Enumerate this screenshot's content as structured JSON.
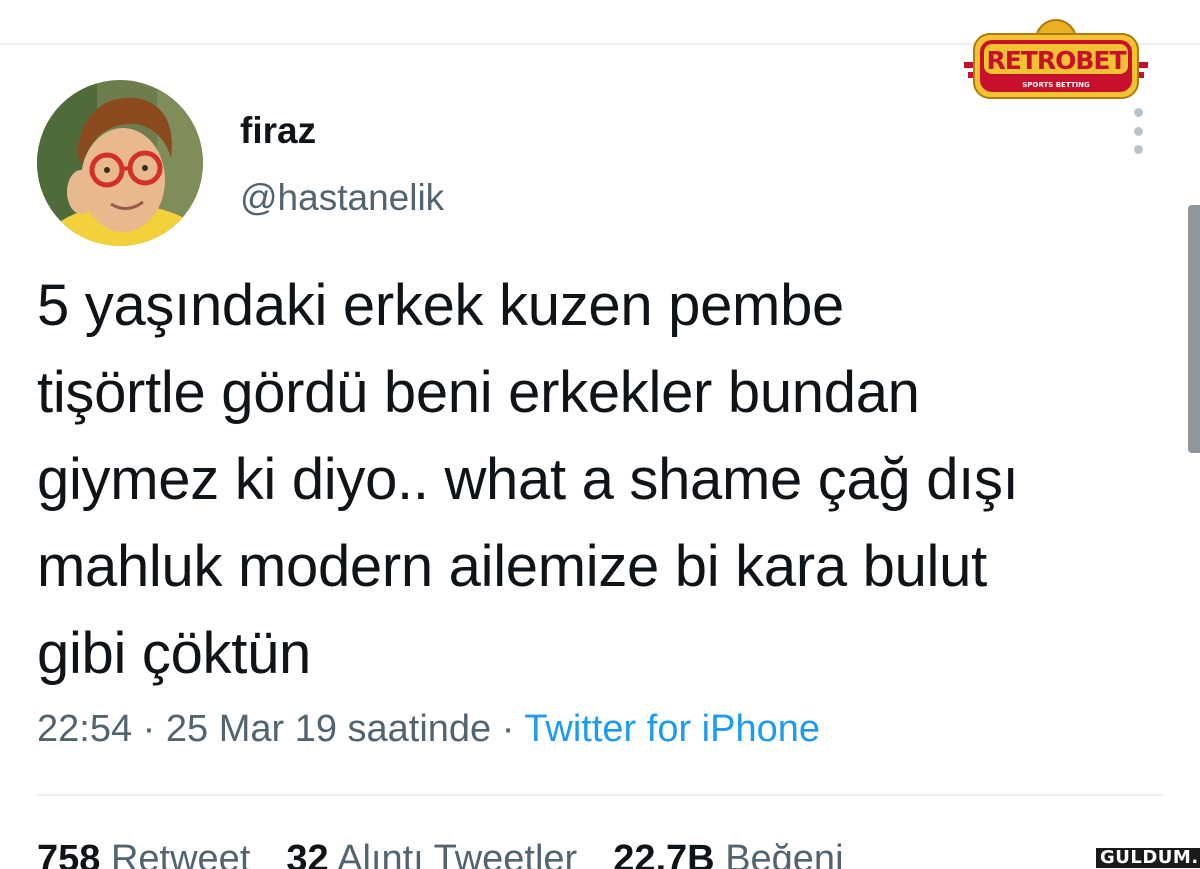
{
  "tweet": {
    "author": {
      "display_name": "firaz",
      "handle": "@hastanelik"
    },
    "text_lines": [
      "5 yaşındaki erkek kuzen pembe",
      "tişörtle gördü beni erkekler bundan",
      "giymez ki diyo.. what a shame çağ dışı",
      "mahluk modern ailemize bi kara bulut",
      "gibi çöktün"
    ],
    "time": "22:54",
    "date": "25 Mar 19 saatinde",
    "separator": "·",
    "source": "Twitter for iPhone",
    "stats": {
      "retweets_count": "758",
      "retweets_label": "Retweet",
      "quotes_count": "32",
      "quotes_label": "Alıntı Tweetler",
      "likes_count": "22,7B",
      "likes_label": "Beğeni"
    }
  },
  "icons": {
    "more": "more-vertical-icon"
  },
  "overlay": {
    "logo_text": "RETROBET",
    "logo_subtext": "SPORTS BETTING",
    "watermark": "GULDUM.NET"
  },
  "colors": {
    "text_primary": "#0f1419",
    "text_secondary": "#536471",
    "link": "#1d9bf0",
    "logo_red": "#c8102e",
    "logo_gold": "#f2c230"
  }
}
